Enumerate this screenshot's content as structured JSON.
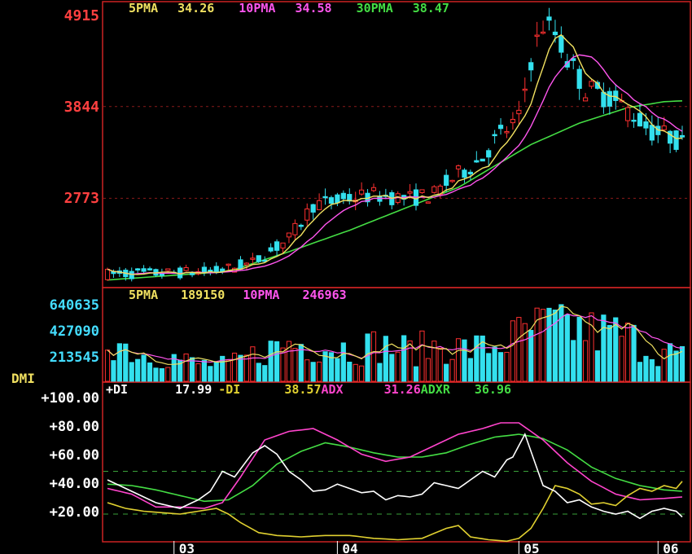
{
  "colors": {
    "background": "#000000",
    "frame": "#cc2222",
    "grid": "#8a1a1a",
    "up": "#ff3030",
    "down": "#33e0ee",
    "ma5": "#f0e060",
    "ma10": "#ff55ee",
    "ma30": "#44dd44",
    "price_axis": "#ff4040",
    "volume_axis": "#44ddff",
    "dmi_axis": "#ffffff",
    "pdi": "#ffffff",
    "mdi": "#e0d030",
    "adx": "#ff44cc",
    "adxr": "#44dd44",
    "date_axis": "#ffffff"
  },
  "price_panel": {
    "ticks": [
      "4915",
      "3844",
      "2773"
    ],
    "tick_values": [
      4915,
      3844,
      2773
    ],
    "ylim": [
      1760,
      4915
    ],
    "legend": [
      {
        "label": "5PMA",
        "value": "34.26",
        "color": "#f0e060"
      },
      {
        "label": "10PMA",
        "value": "34.58",
        "color": "#ff55ee"
      },
      {
        "label": "30PMA",
        "value": "38.47",
        "color": "#44dd44"
      }
    ]
  },
  "volume_panel": {
    "ticks": [
      "640635",
      "427090",
      "213545"
    ],
    "tick_values": [
      640635,
      427090,
      213545
    ],
    "ylim": [
      0,
      720000
    ],
    "legend": [
      {
        "label": "5PMA",
        "value": "189150",
        "color": "#f0e060"
      },
      {
        "label": "10PMA",
        "value": "246963",
        "color": "#ff55ee"
      }
    ]
  },
  "dmi_panel": {
    "title": "DMI",
    "ticks": [
      "+100.00",
      "+80.00",
      "+60.00",
      "+40.00",
      "+20.00"
    ],
    "tick_values": [
      100,
      80,
      60,
      40,
      20
    ],
    "ylim": [
      0,
      100
    ],
    "ref_lines": [
      50,
      20
    ],
    "legend": [
      {
        "label": "+DI",
        "value": "17.99",
        "color": "#ffffff"
      },
      {
        "label": "-DI",
        "value": "38.57",
        "color": "#e0d030"
      },
      {
        "label": "ADX",
        "value": "31.26",
        "color": "#ff44cc"
      },
      {
        "label": "ADXR",
        "value": "36.96",
        "color": "#44dd44"
      }
    ]
  },
  "date_axis": {
    "labels": [
      {
        "text": "03",
        "index": 11
      },
      {
        "text": "04",
        "index": 38
      },
      {
        "text": "05",
        "index": 68
      },
      {
        "text": "06",
        "index": 91
      }
    ]
  },
  "chart_data": {
    "type": "candlestick",
    "count": 96,
    "price_path": [
      [
        0,
        1890
      ],
      [
        10,
        1900
      ],
      [
        18,
        1920
      ],
      [
        24,
        2020
      ],
      [
        30,
        2300
      ],
      [
        34,
        2700
      ],
      [
        38,
        2740
      ],
      [
        41,
        2790
      ],
      [
        44,
        2810
      ],
      [
        50,
        2770
      ],
      [
        54,
        2820
      ],
      [
        57,
        3000
      ],
      [
        62,
        3250
      ],
      [
        64,
        3450
      ],
      [
        68,
        3700
      ],
      [
        70,
        4400
      ],
      [
        72,
        4800
      ],
      [
        74,
        4700
      ],
      [
        76,
        4400
      ],
      [
        79,
        4050
      ],
      [
        83,
        3950
      ],
      [
        87,
        3750
      ],
      [
        90,
        3550
      ],
      [
        93,
        3500
      ],
      [
        95,
        3400
      ]
    ],
    "price_noise": 0.035,
    "ma30_path": [
      [
        0,
        1820
      ],
      [
        20,
        1920
      ],
      [
        30,
        2150
      ],
      [
        40,
        2400
      ],
      [
        50,
        2680
      ],
      [
        58,
        2900
      ],
      [
        64,
        3150
      ],
      [
        70,
        3400
      ],
      [
        78,
        3650
      ],
      [
        86,
        3830
      ],
      [
        92,
        3900
      ],
      [
        95,
        3910
      ]
    ],
    "volume_path": [
      [
        0,
        430000
      ],
      [
        5,
        250000
      ],
      [
        10,
        230000
      ],
      [
        15,
        160000
      ],
      [
        20,
        150000
      ],
      [
        25,
        260000
      ],
      [
        30,
        350000
      ],
      [
        35,
        330000
      ],
      [
        40,
        300000
      ],
      [
        45,
        330000
      ],
      [
        50,
        280000
      ],
      [
        55,
        330000
      ],
      [
        60,
        290000
      ],
      [
        65,
        340000
      ],
      [
        70,
        470000
      ],
      [
        75,
        520000
      ],
      [
        80,
        450000
      ],
      [
        85,
        430000
      ],
      [
        90,
        300000
      ],
      [
        95,
        230000
      ]
    ],
    "pdi_path": [
      [
        0,
        44
      ],
      [
        4,
        36
      ],
      [
        8,
        28
      ],
      [
        12,
        24
      ],
      [
        15,
        30
      ],
      [
        17,
        36
      ],
      [
        19,
        50
      ],
      [
        21,
        46
      ],
      [
        24,
        63
      ],
      [
        26,
        68
      ],
      [
        28,
        62
      ],
      [
        30,
        50
      ],
      [
        32,
        44
      ],
      [
        34,
        36
      ],
      [
        36,
        37
      ],
      [
        38,
        41
      ],
      [
        40,
        38
      ],
      [
        42,
        35
      ],
      [
        44,
        36
      ],
      [
        46,
        30
      ],
      [
        48,
        33
      ],
      [
        50,
        32
      ],
      [
        52,
        34
      ],
      [
        54,
        42
      ],
      [
        56,
        40
      ],
      [
        58,
        38
      ],
      [
        60,
        44
      ],
      [
        62,
        50
      ],
      [
        64,
        46
      ],
      [
        66,
        58
      ],
      [
        67,
        60
      ],
      [
        69,
        76
      ],
      [
        71,
        52
      ],
      [
        72,
        40
      ],
      [
        74,
        36
      ],
      [
        76,
        28
      ],
      [
        78,
        30
      ],
      [
        80,
        25
      ],
      [
        82,
        22
      ],
      [
        84,
        20
      ],
      [
        86,
        22
      ],
      [
        88,
        17
      ],
      [
        90,
        22
      ],
      [
        92,
        24
      ],
      [
        94,
        22
      ],
      [
        95,
        18
      ]
    ],
    "mdi_path": [
      [
        0,
        28
      ],
      [
        3,
        24
      ],
      [
        6,
        22
      ],
      [
        9,
        21
      ],
      [
        12,
        20
      ],
      [
        15,
        22
      ],
      [
        18,
        24
      ],
      [
        20,
        20
      ],
      [
        22,
        14
      ],
      [
        25,
        7
      ],
      [
        28,
        5
      ],
      [
        32,
        4
      ],
      [
        36,
        5
      ],
      [
        40,
        5
      ],
      [
        44,
        3
      ],
      [
        48,
        2
      ],
      [
        52,
        3
      ],
      [
        56,
        10
      ],
      [
        58,
        12
      ],
      [
        60,
        4
      ],
      [
        63,
        2
      ],
      [
        66,
        1
      ],
      [
        68,
        3
      ],
      [
        70,
        10
      ],
      [
        72,
        24
      ],
      [
        74,
        40
      ],
      [
        76,
        38
      ],
      [
        78,
        34
      ],
      [
        80,
        27
      ],
      [
        82,
        28
      ],
      [
        84,
        26
      ],
      [
        86,
        33
      ],
      [
        88,
        38
      ],
      [
        90,
        36
      ],
      [
        92,
        40
      ],
      [
        94,
        38
      ],
      [
        95,
        43
      ]
    ],
    "adx_path": [
      [
        0,
        38
      ],
      [
        4,
        34
      ],
      [
        8,
        25
      ],
      [
        12,
        25
      ],
      [
        16,
        24
      ],
      [
        19,
        28
      ],
      [
        22,
        46
      ],
      [
        26,
        72
      ],
      [
        30,
        78
      ],
      [
        34,
        80
      ],
      [
        38,
        72
      ],
      [
        42,
        62
      ],
      [
        46,
        57
      ],
      [
        50,
        60
      ],
      [
        54,
        68
      ],
      [
        58,
        76
      ],
      [
        62,
        80
      ],
      [
        65,
        84
      ],
      [
        68,
        84
      ],
      [
        72,
        72
      ],
      [
        76,
        56
      ],
      [
        80,
        43
      ],
      [
        84,
        34
      ],
      [
        88,
        30
      ],
      [
        92,
        31
      ],
      [
        95,
        32
      ]
    ],
    "adxr_path": [
      [
        0,
        41
      ],
      [
        4,
        40
      ],
      [
        8,
        37
      ],
      [
        12,
        33
      ],
      [
        16,
        29
      ],
      [
        20,
        30
      ],
      [
        24,
        40
      ],
      [
        28,
        55
      ],
      [
        32,
        64
      ],
      [
        36,
        70
      ],
      [
        40,
        67
      ],
      [
        44,
        63
      ],
      [
        48,
        60
      ],
      [
        52,
        60
      ],
      [
        56,
        63
      ],
      [
        60,
        69
      ],
      [
        64,
        74
      ],
      [
        68,
        76
      ],
      [
        72,
        73
      ],
      [
        76,
        65
      ],
      [
        80,
        53
      ],
      [
        84,
        45
      ],
      [
        88,
        40
      ],
      [
        92,
        37
      ],
      [
        95,
        36
      ]
    ]
  }
}
